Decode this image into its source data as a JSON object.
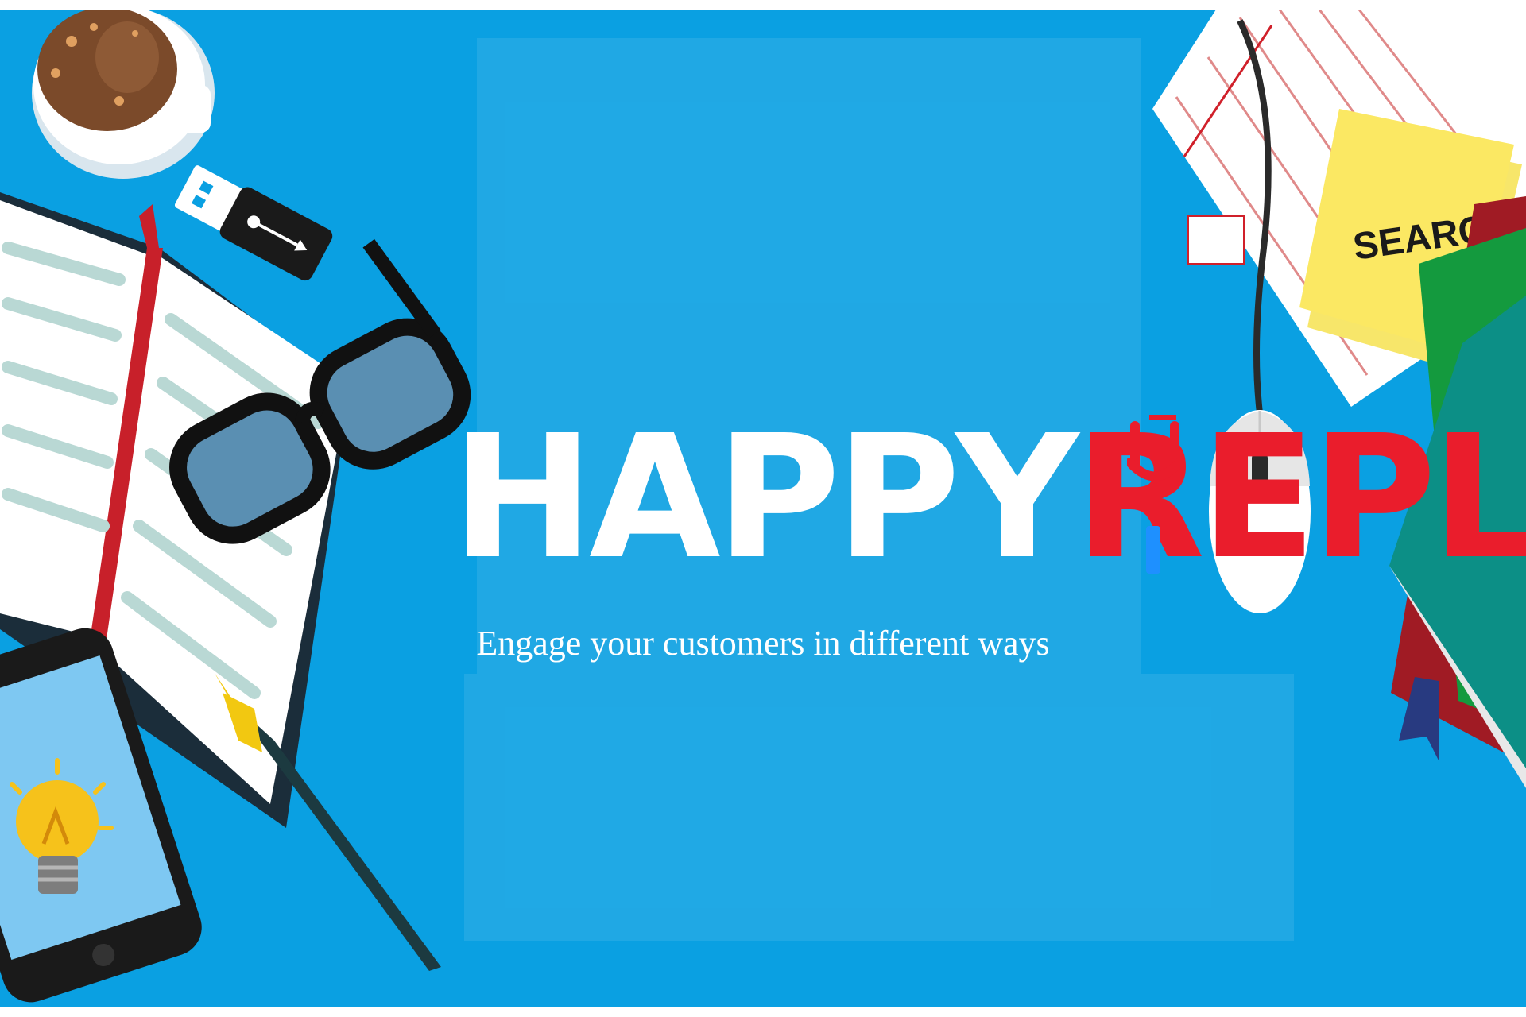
{
  "brand": {
    "word_part1": "HAPPY",
    "word_part2": "REPL",
    "color_part1": "#ffffff",
    "color_part2": "#ea1d2c",
    "smile_color": "#ea1d2c",
    "dot_color": "#1e90ff"
  },
  "tagline": "Engage your customers in different ways",
  "sticky_note": {
    "text": "SEARCH"
  },
  "background": {
    "color": "#0aa0e2"
  },
  "illustration": {
    "items": [
      "coffee-cup-icon",
      "usb-drive-icon",
      "open-book-icon",
      "glasses-icon",
      "fountain-pen-icon",
      "smartphone-icon",
      "light-bulb-icon",
      "notepad-icon",
      "mouse-icon",
      "sticky-note-icon",
      "book-stack-icon"
    ]
  }
}
